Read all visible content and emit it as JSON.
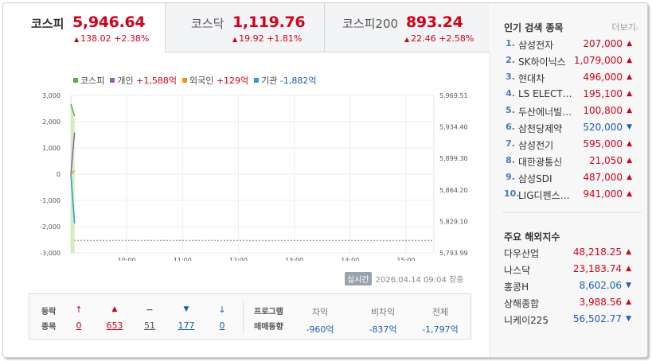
{
  "tabs": [
    {
      "name": "코스피",
      "value": "5,946.64",
      "change": "138.02 +2.38%",
      "dir": "up"
    },
    {
      "name": "코스닥",
      "value": "1,119.76",
      "change": "19.92 +1.81%",
      "dir": "up"
    },
    {
      "name": "코스피200",
      "value": "893.24",
      "change": "22.46 +2.58%",
      "dir": "up"
    }
  ],
  "legend": [
    {
      "name": "코스피",
      "value": "",
      "color": "#52b53b"
    },
    {
      "name": "개인",
      "value": "+1,588억",
      "color": "#9b59b6",
      "sign": "pos"
    },
    {
      "name": "외국인",
      "value": "+129억",
      "color": "#f0921e",
      "sign": "pos"
    },
    {
      "name": "기관",
      "value": "-1,882억",
      "color": "#2a9fd8",
      "sign": "neg"
    }
  ],
  "chart_data": {
    "type": "line",
    "y_left_ticks": [
      "3,000",
      "2,000",
      "1,000",
      "0",
      "-1,000",
      "-2,000",
      "-3,000"
    ],
    "y_right_ticks": [
      "5,969.51",
      "5,934.40",
      "5,899.30",
      "5,864.20",
      "5,829.10",
      "5,793.99"
    ],
    "x_ticks": [
      "10:00",
      "11:00",
      "12:00",
      "13:00",
      "14:00",
      "15:00"
    ],
    "ylim_left": [
      -3000,
      3000
    ],
    "ylim_right": [
      5793.99,
      5969.51
    ],
    "xlim": [
      "09:00",
      "15:30"
    ],
    "grid": true,
    "reference_line_right": 5808,
    "series": [
      {
        "name": "코스피",
        "axis": "right",
        "color": "#52b53b",
        "fill": true,
        "x": [
          "09:00",
          "09:04"
        ],
        "values": [
          5960,
          5946.64
        ]
      },
      {
        "name": "개인",
        "axis": "left",
        "color": "#9b59b6",
        "x": [
          "09:00",
          "09:04"
        ],
        "values": [
          0,
          1588
        ]
      },
      {
        "name": "외국인",
        "axis": "left",
        "color": "#f0921e",
        "x": [
          "09:00",
          "09:04"
        ],
        "values": [
          0,
          129
        ]
      },
      {
        "name": "기관",
        "axis": "left",
        "color": "#2a9fd8",
        "x": [
          "09:00",
          "09:04"
        ],
        "values": [
          0,
          -1882
        ]
      }
    ]
  },
  "stamp": {
    "badge": "실시간",
    "datetime": "2026.04.14 09:04",
    "status": "장중"
  },
  "breadth": {
    "label_line1": "등락",
    "label_line2": "종목",
    "items": [
      {
        "icon": "upper-limit",
        "glyph": "🠉",
        "count": "0",
        "cls": "up"
      },
      {
        "icon": "rise",
        "glyph": "▲",
        "count": "653",
        "cls": "up"
      },
      {
        "icon": "unchanged",
        "glyph": "━",
        "count": "51",
        "cls": "flat"
      },
      {
        "icon": "fall",
        "glyph": "▼",
        "count": "177",
        "cls": "down"
      },
      {
        "icon": "lower-limit",
        "glyph": "🠋",
        "count": "0",
        "cls": "down"
      }
    ]
  },
  "program": {
    "label_line1": "프로그램",
    "label_line2": "매매동향",
    "cols": [
      {
        "head": "차익",
        "value": "-960억"
      },
      {
        "head": "비차익",
        "value": "-837억"
      },
      {
        "head": "전체",
        "value": "-1,797억"
      }
    ]
  },
  "popular": {
    "title": "인기 검색 종목",
    "more": "더보기",
    "items": [
      {
        "rank": "1.",
        "name": "삼성전자",
        "price": "207,000",
        "dir": "up"
      },
      {
        "rank": "2.",
        "name": "SK하이닉스",
        "price": "1,079,000",
        "dir": "up"
      },
      {
        "rank": "3.",
        "name": "현대차",
        "price": "496,000",
        "dir": "up"
      },
      {
        "rank": "4.",
        "name": "LS ELECT…",
        "price": "195,100",
        "dir": "up"
      },
      {
        "rank": "5.",
        "name": "두산에너빌…",
        "price": "100,800",
        "dir": "up"
      },
      {
        "rank": "6.",
        "name": "삼천당제약",
        "price": "520,000",
        "dir": "down"
      },
      {
        "rank": "7.",
        "name": "삼성전기",
        "price": "595,000",
        "dir": "up"
      },
      {
        "rank": "8.",
        "name": "대한광통신",
        "price": "21,050",
        "dir": "up"
      },
      {
        "rank": "9.",
        "name": "삼성SDI",
        "price": "487,000",
        "dir": "up"
      },
      {
        "rank": "10.",
        "name": "LIG디펜스…",
        "price": "941,000",
        "dir": "up"
      }
    ]
  },
  "overseas": {
    "title": "주요 해외지수",
    "items": [
      {
        "name": "다우산업",
        "price": "48,218.25",
        "dir": "up"
      },
      {
        "name": "나스닥",
        "price": "23,183.74",
        "dir": "up"
      },
      {
        "name": "홍콩H",
        "price": "8,602.06",
        "dir": "down"
      },
      {
        "name": "상해종합",
        "price": "3,988.56",
        "dir": "up"
      },
      {
        "name": "니케이225",
        "price": "56,502.77",
        "dir": "down"
      }
    ]
  },
  "colors": {
    "up": "#d0021b",
    "down": "#1a5fb4"
  }
}
